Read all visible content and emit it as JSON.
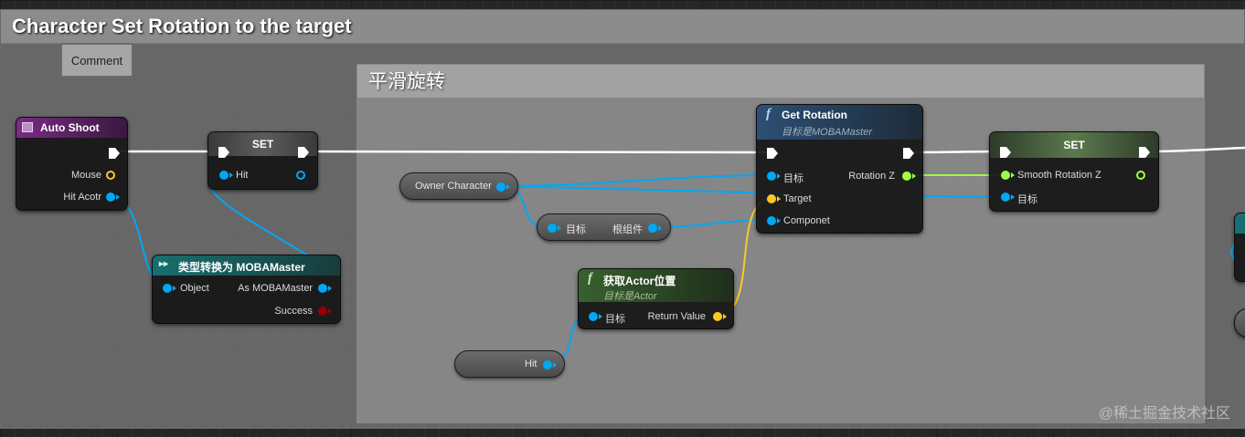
{
  "comments": {
    "outer_title": "Character Set Rotation to the target",
    "inner_title": "平滑旋转",
    "comment_button": "Comment"
  },
  "nodes": {
    "auto_shoot": {
      "title": "Auto Shoot",
      "pins": {
        "mouse": "Mouse",
        "hit_actor": "Hit Acotr"
      }
    },
    "set_hit": {
      "title": "SET",
      "pins": {
        "hit": "Hit"
      }
    },
    "cast": {
      "title": "类型转换为 MOBAMaster",
      "pins": {
        "object": "Object",
        "as": "As MOBAMaster",
        "success": "Success"
      }
    },
    "owner_character": {
      "label": "Owner Character"
    },
    "root_component": {
      "pins": {
        "target": "目标",
        "root": "根组件"
      }
    },
    "get_rotation": {
      "title": "Get Rotation",
      "subtitle": "目标是MOBAMaster",
      "pins": {
        "target_in": "目标",
        "rotation_z": "Rotation Z",
        "target": "Target",
        "componet": "Componet"
      }
    },
    "get_actor_location": {
      "title": "获取Actor位置",
      "subtitle": "目标是Actor",
      "pins": {
        "target": "目标",
        "return_value": "Return Value"
      }
    },
    "hit_getter": {
      "label": "Hit"
    },
    "set_smooth": {
      "title": "SET",
      "pins": {
        "smooth": "Smooth Rotation Z",
        "target": "目标"
      }
    }
  },
  "colors": {
    "object_pin": "#00a8f4",
    "vector_pin": "#fdc826",
    "float_pin": "#9fff44",
    "bool_pin": "#920101",
    "exec_wire": "#ffffff",
    "event_header": "#7b2a86",
    "function_header": "#2c4f74",
    "set_header": "#5c5c5c",
    "cast_header": "#186f6f",
    "pure_header": "#38612e"
  },
  "watermark": "@稀土掘金技术社区"
}
